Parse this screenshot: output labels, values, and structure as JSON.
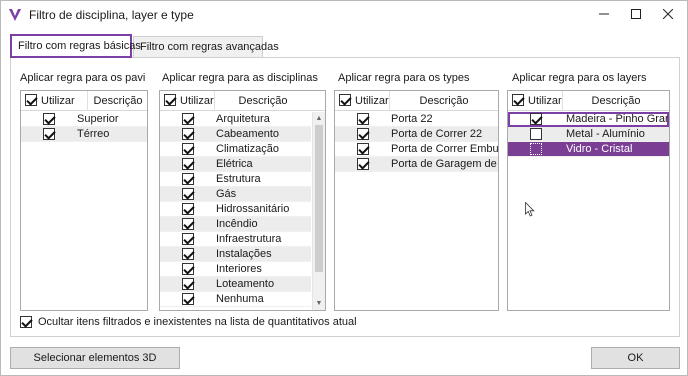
{
  "window": {
    "title": "Filtro de disciplina, layer e type",
    "icon": "app-logo-v-icon",
    "controls": [
      "minimize-icon",
      "maximize-icon",
      "close-icon"
    ]
  },
  "tabs": [
    {
      "label": "Filtro com regras básicas",
      "active": true
    },
    {
      "label": "Filtro com regras avançadas",
      "active": false
    }
  ],
  "accent_color": "#7b3fa6",
  "groups": {
    "pavimentos": {
      "label": "Aplicar regra para os pavimentos",
      "header": {
        "util": "Utilizar",
        "desc": "Descrição"
      },
      "rows": [
        {
          "label": "Superior",
          "checked": true
        },
        {
          "label": "Térreo",
          "checked": true
        }
      ]
    },
    "disciplinas": {
      "label": "Aplicar regra para as disciplinas",
      "header": {
        "util": "Utilizar",
        "desc": "Descrição"
      },
      "rows": [
        {
          "label": "Arquitetura",
          "checked": true
        },
        {
          "label": "Cabeamento",
          "checked": true
        },
        {
          "label": "Climatização",
          "checked": true
        },
        {
          "label": "Elétrica",
          "checked": true
        },
        {
          "label": "Estrutura",
          "checked": true
        },
        {
          "label": "Gás",
          "checked": true
        },
        {
          "label": "Hidrossanitário",
          "checked": true
        },
        {
          "label": "Incêndio",
          "checked": true
        },
        {
          "label": "Infraestrutura",
          "checked": true
        },
        {
          "label": "Instalações",
          "checked": true
        },
        {
          "label": "Interiores",
          "checked": true
        },
        {
          "label": "Loteamento",
          "checked": true
        },
        {
          "label": "Nenhuma",
          "checked": true
        }
      ]
    },
    "types": {
      "label": "Aplicar regra para os types",
      "header": {
        "util": "Utilizar",
        "desc": "Descrição"
      },
      "rows": [
        {
          "label": "Porta 22",
          "checked": true
        },
        {
          "label": "Porta de Correr 22",
          "checked": true
        },
        {
          "label": "Porta de Correr Embutida",
          "checked": true
        },
        {
          "label": "Porta de Garagem de Correr",
          "checked": true
        }
      ]
    },
    "layers": {
      "label": "Aplicar regra para os layers",
      "header": {
        "util": "Utilizar",
        "desc": "Descrição"
      },
      "rows": [
        {
          "label": "Madeira - Pinho Granulado",
          "checked": true
        },
        {
          "label": "Metal - Alumínio",
          "checked": false
        },
        {
          "label": "Vidro - Cristal",
          "checked": false
        }
      ]
    }
  },
  "bottom_option": {
    "label": "Ocultar itens filtrados e inexistentes na lista de quantitativos atual",
    "checked": true
  },
  "buttons": {
    "select3d": "Selecionar elementos 3D",
    "ok": "OK"
  }
}
